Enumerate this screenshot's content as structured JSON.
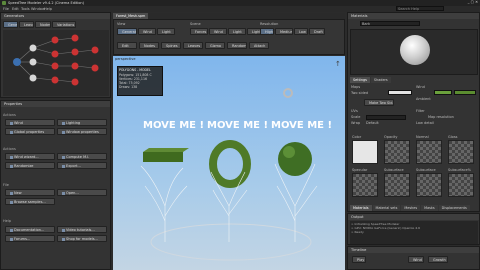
{
  "window": {
    "title": "SpeedTree Modeler v9.4.2 (Cinema Edition)",
    "search_help": "Search Help"
  },
  "menu": [
    "File",
    "Edit",
    "Tools",
    "Window",
    "Help"
  ],
  "toolbar_top": {
    "generators": "Generators",
    "icons": [
      "Leaves",
      "Nodes",
      "Variations"
    ]
  },
  "tree_panel_title": "Generators",
  "scene_tab": "Forest_Mesh.spm",
  "scene_toolbar": {
    "groups": [
      {
        "title": "View",
        "buttons": [
          "Generate",
          "Wind",
          "Light"
        ]
      },
      {
        "title": "Scene",
        "buttons": [
          "Forces",
          "Wind",
          "Light",
          "Lights"
        ]
      },
      {
        "title": "Resolution",
        "buttons": [
          "High",
          "Medium",
          "Low",
          "Draft"
        ]
      }
    ],
    "row2": [
      "Edit",
      "Nodes",
      "Spines",
      "Leaves",
      "Gizmo",
      "Random",
      "Attach"
    ]
  },
  "viewport": {
    "label": "perspective",
    "stats": {
      "title": "POLYGONS - MODEL",
      "rows": [
        [
          "Polygons",
          "151,808 C"
        ],
        [
          "Vertices",
          "231,116"
        ],
        [
          "Total",
          "75,092"
        ],
        [
          "Draws",
          "138"
        ]
      ]
    },
    "move_me_texts": [
      "MOVE ME !",
      "MOVE ME !",
      "MOVE ME !"
    ]
  },
  "properties": {
    "title": "Properties",
    "sections": [
      {
        "name": "Actions",
        "buttons": [
          "Wind",
          "Lighting",
          "Global properties",
          "Window properties"
        ]
      },
      {
        "name": "Actions",
        "buttons": [
          "Wind wizard...",
          "Compute M.I.",
          "Randomize",
          "Export..."
        ]
      },
      {
        "name": "File",
        "buttons": [
          "New",
          "Open...",
          "Browse samples..."
        ]
      },
      {
        "name": "Help",
        "buttons": [
          "Documentation...",
          "Video tutorials...",
          "Forums...",
          "Shop for models..."
        ]
      }
    ]
  },
  "materials": {
    "title": "Materials",
    "name": "Bark",
    "tabs": [
      "Settings",
      "Shaders"
    ],
    "maps_label": "Maps",
    "flags": [
      "Two sided",
      "Wind"
    ],
    "flags2": [
      "Ambient",
      "Leaf"
    ],
    "make_button": "Make Two Sid...",
    "uv_label": "UVs",
    "scale_label": "Scale",
    "wrap_label": "Wrap",
    "wrap_value": "Default",
    "tile_label": "Tile",
    "tile_value": "Default",
    "filter_label": "Filter",
    "filter_value": "Map resolution",
    "lod_label": "Low detail",
    "maps": [
      "Color",
      "Opacity",
      "Normal",
      "Gloss",
      "Specular",
      "Subsurface",
      "Subsurface",
      "Subsurface%"
    ],
    "bottom_tabs": [
      "Materials",
      "Material sets",
      "Meshes",
      "Masks",
      "Displacements"
    ]
  },
  "output": {
    "title": "Output",
    "lines": [
      "> Initializing SpeedTree Modeler",
      "> GPU: NVIDIA GeForce (Generic) OpenGL 4.6",
      "> Ready"
    ]
  },
  "timeline": {
    "title": "Timeline",
    "controls": [
      "Play",
      "Wind",
      "Growth"
    ]
  }
}
